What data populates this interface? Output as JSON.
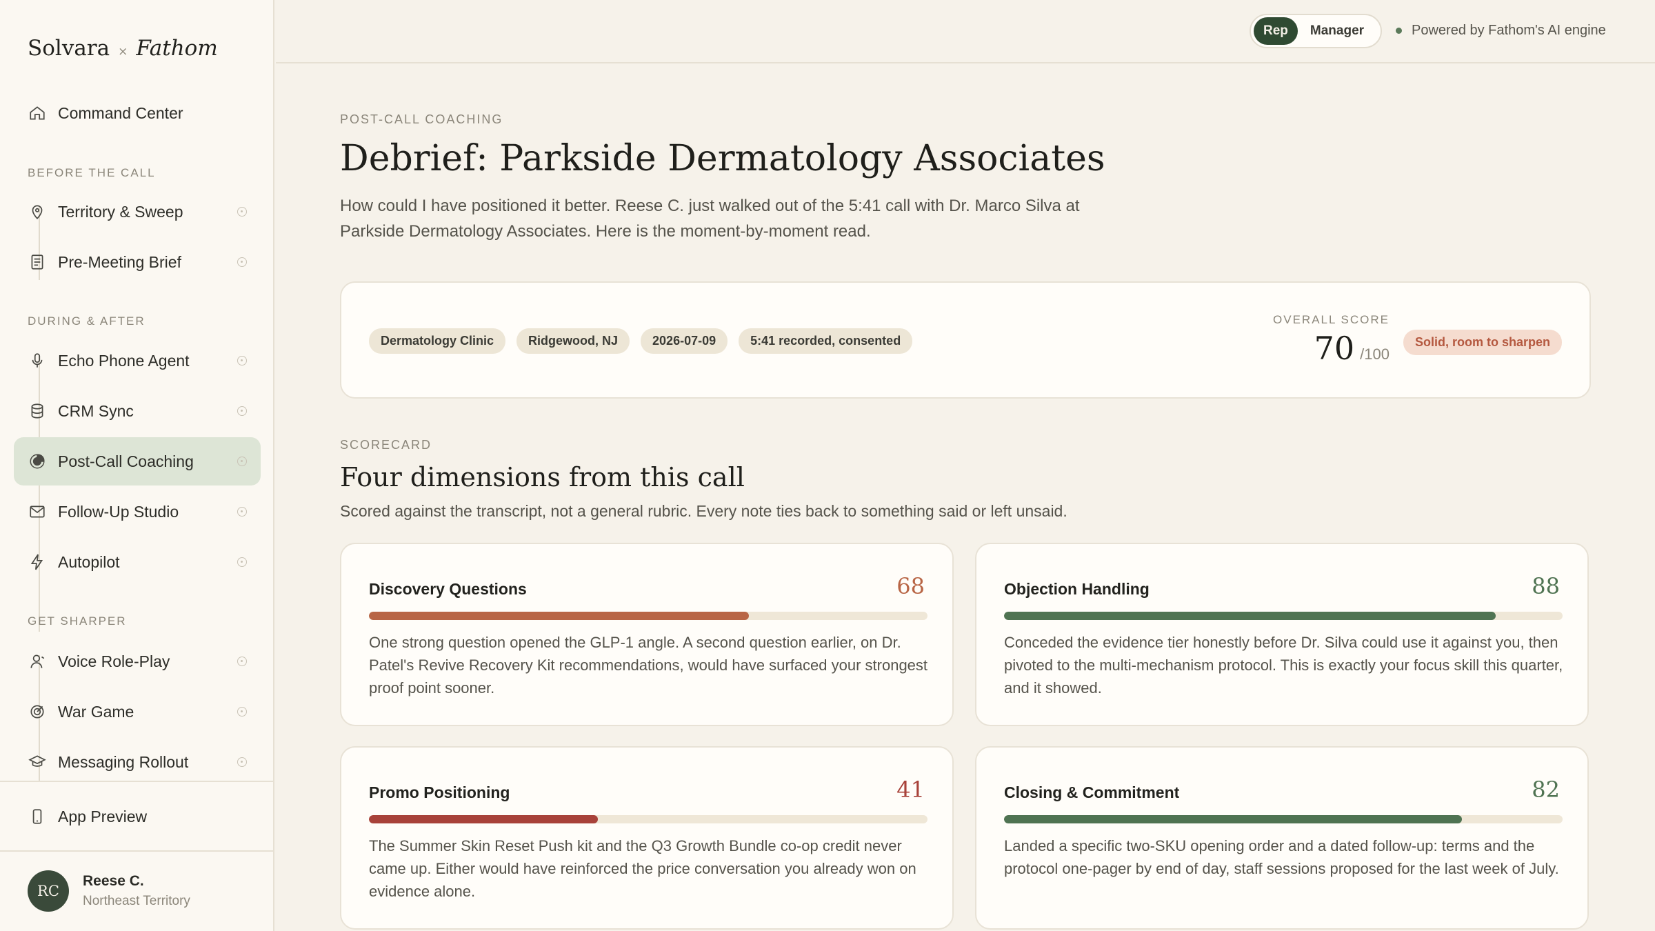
{
  "brand": {
    "left": "Solvara",
    "sep": "×",
    "right": "Fathom"
  },
  "sidebar": {
    "top_item": {
      "label": "Command Center",
      "icon": "home-icon"
    },
    "sections": [
      {
        "label": "BEFORE THE CALL"
      },
      {
        "label": "DURING & AFTER"
      },
      {
        "label": "GET SHARPER"
      }
    ],
    "items": [
      {
        "label": "Territory & Sweep",
        "icon": "map-pin-icon"
      },
      {
        "label": "Pre-Meeting Brief",
        "icon": "document-icon"
      },
      {
        "label": "Echo Phone Agent",
        "icon": "microphone-icon"
      },
      {
        "label": "CRM Sync",
        "icon": "database-icon"
      },
      {
        "label": "Post-Call Coaching",
        "icon": "pie-chart-icon",
        "active": true
      },
      {
        "label": "Follow-Up Studio",
        "icon": "mail-icon"
      },
      {
        "label": "Autopilot",
        "icon": "bolt-icon"
      },
      {
        "label": "Voice Role-Play",
        "icon": "person-icon"
      },
      {
        "label": "War Game",
        "icon": "target-icon"
      },
      {
        "label": "Messaging Rollout",
        "icon": "graduation-cap-icon"
      }
    ],
    "app_preview": {
      "label": "App Preview",
      "icon": "phone-icon"
    },
    "user": {
      "initials": "RC",
      "name": "Reese C.",
      "territory": "Northeast Territory"
    }
  },
  "topbar": {
    "toggle": {
      "rep": "Rep",
      "manager": "Manager",
      "selected": "Rep"
    },
    "powered": "Powered by Fathom's AI engine"
  },
  "page": {
    "eyebrow": "POST-CALL COACHING",
    "title": "Debrief: Parkside Dermatology Associates",
    "intro": "How could I have positioned it better. Reese C. just walked out of the 5:41 call with Dr. Marco Silva at Parkside Dermatology Associates. Here is the moment-by-moment read."
  },
  "summary": {
    "chips": [
      "Dermatology Clinic",
      "Ridgewood, NJ",
      "2026-07-09",
      "5:41 recorded, consented"
    ],
    "score_label": "OVERALL SCORE",
    "score": "70",
    "score_of": "/100",
    "badge": "Solid, room to sharpen"
  },
  "scorecard": {
    "eyebrow": "SCORECARD",
    "title": "Four dimensions from this call",
    "subtitle": "Scored against the transcript, not a general rubric. Every note ties back to something said or left unsaid.",
    "cards": [
      {
        "title": "Discovery Questions",
        "score": "68",
        "progress": 0.68,
        "color": "#b86545",
        "body": "One strong question opened the GLP-1 angle. A second question earlier, on Dr. Patel's Revive Recovery Kit recommendations, would have surfaced your strongest proof point sooner."
      },
      {
        "title": "Objection Handling",
        "score": "88",
        "progress": 0.88,
        "color": "#4f7352",
        "body": "Conceded the evidence tier honestly before Dr. Silva could use it against you, then pivoted to the multi-mechanism protocol. This is exactly your focus skill this quarter, and it showed."
      },
      {
        "title": "Promo Positioning",
        "score": "41",
        "progress": 0.41,
        "color": "#a8423a",
        "body": "The Summer Skin Reset Push kit and the Q3 Growth Bundle co-op credit never came up. Either would have reinforced the price conversation you already won on evidence alone."
      },
      {
        "title": "Closing & Commitment",
        "score": "82",
        "progress": 0.82,
        "color": "#4f7352",
        "body": "Landed a specific two-SKU opening order and a dated follow-up: terms and the protocol one-pager by end of day, staff sessions proposed for the last week of July."
      }
    ]
  }
}
